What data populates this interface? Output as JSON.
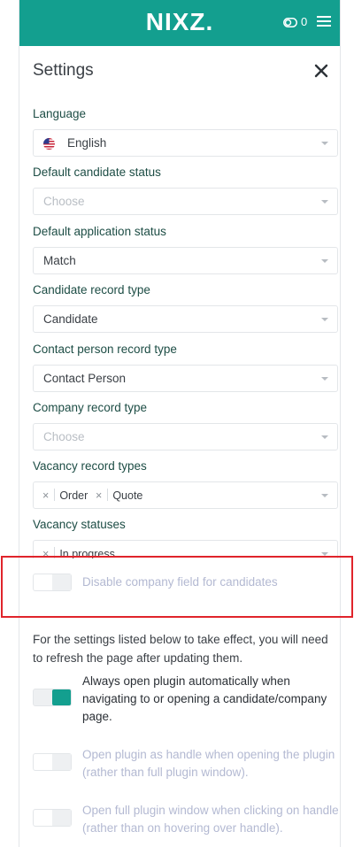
{
  "header": {
    "logo": "NIXZ.",
    "count": "0",
    "accent": "#139f8f"
  },
  "settings": {
    "title": "Settings",
    "language": {
      "label": "Language",
      "value": "English"
    },
    "default_candidate_status": {
      "label": "Default candidate status",
      "placeholder": "Choose"
    },
    "default_application_status": {
      "label": "Default application status",
      "value": "Match"
    },
    "candidate_record_type": {
      "label": "Candidate record type",
      "value": "Candidate"
    },
    "contact_person_record_type": {
      "label": "Contact person record type",
      "value": "Contact Person"
    },
    "company_record_type": {
      "label": "Company record type",
      "placeholder": "Choose"
    },
    "vacancy_record_types": {
      "label": "Vacancy record types",
      "tags": [
        "Order",
        "Quote"
      ]
    },
    "vacancy_statuses": {
      "label": "Vacancy statuses",
      "tags": [
        "In progress"
      ]
    },
    "disable_company_field": {
      "label": "Disable company field for candidates",
      "enabled": false
    },
    "refresh_note": "For the settings listed below to take effect, you will need to refresh the page after updating them.",
    "options": [
      {
        "label": "Always open plugin automatically when navigating to or opening a candidate/company page.",
        "enabled": true
      },
      {
        "label": "Open plugin as handle when opening the plugin (rather than full plugin window).",
        "enabled": false
      },
      {
        "label": "Open full plugin window when clicking on handle (rather than on hovering over handle).",
        "enabled": false
      }
    ]
  }
}
